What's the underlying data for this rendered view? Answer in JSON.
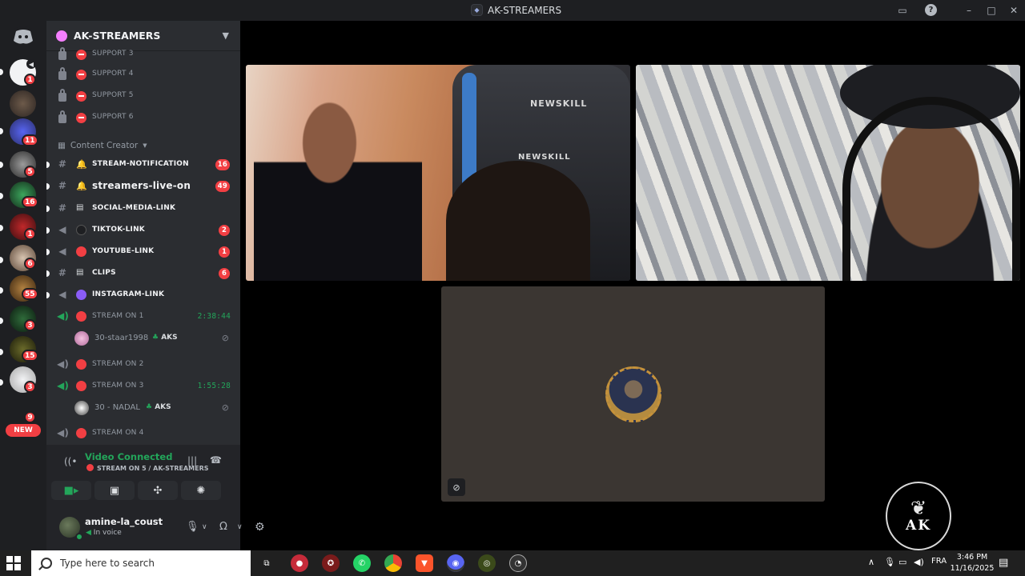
{
  "window": {
    "title": "AK-STREAMERS"
  },
  "server": {
    "name": "AK-STREAMERS"
  },
  "rail_badges": [
    "1",
    "11",
    "5",
    "16",
    "1",
    "6",
    "55",
    "3",
    "15",
    "3",
    "9"
  ],
  "rail_new_label": "NEW",
  "locked_channels": [
    "SUPPORT 3",
    "SUPPORT 4",
    "SUPPORT 5",
    "SUPPORT 6"
  ],
  "category": {
    "name": "Content Creator"
  },
  "text_channels": [
    {
      "name": "STREAM-NOTIFICATION",
      "count": "16"
    },
    {
      "name": "streamers-live-on",
      "count": "49"
    },
    {
      "name": "SOCIAL-MEDIA-LINK",
      "count": ""
    },
    {
      "name": "TIKTOK-LINK",
      "count": "2"
    },
    {
      "name": "YOUTUBE-LINK",
      "count": "1"
    },
    {
      "name": "CLIPS",
      "count": "6"
    },
    {
      "name": "INSTAGRAM-LINK",
      "count": ""
    }
  ],
  "voice_channels": [
    {
      "name": "STREAM ON 1",
      "timer": "2:38:44",
      "user": "30-staar1998",
      "tag": "AKS"
    },
    {
      "name": "STREAM ON 2",
      "timer": ""
    },
    {
      "name": "STREAM ON 3",
      "timer": "1:55:28",
      "user": "30 - NADAL",
      "tag": "AKS"
    },
    {
      "name": "STREAM ON 4",
      "timer": ""
    }
  ],
  "voice_panel": {
    "status": "Video Connected",
    "channel": "STREAM ON 5 / AK-STREAMERS"
  },
  "user_panel": {
    "username": "amine-la_coust",
    "status": "In voice"
  },
  "video_tiles": {
    "brand_text": "NEWSKILL"
  },
  "logo": {
    "text": "AK"
  },
  "taskbar": {
    "search_placeholder": "Type here to search",
    "language": "FRA",
    "time": "3:46 PM",
    "date": "11/16/2025"
  },
  "colors": {
    "accent": "#23a55a",
    "alert": "#f23f43",
    "rail": "#1e1f22",
    "sidebar": "#2b2d31"
  }
}
